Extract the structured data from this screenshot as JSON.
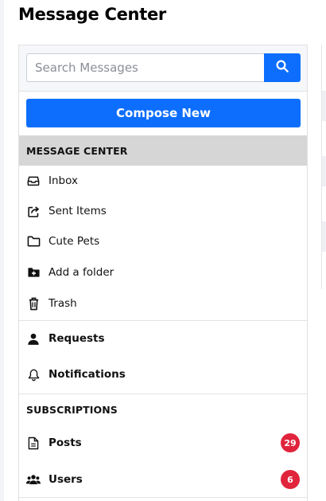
{
  "page": {
    "title": "Message Center"
  },
  "search": {
    "placeholder": "Search Messages",
    "button_icon": "search-icon"
  },
  "compose": {
    "label": "Compose New"
  },
  "colors": {
    "primary": "#0d6efd",
    "badge": "#e0243c",
    "section_header_bg": "#d6d6d6"
  },
  "message_center": {
    "heading": "MESSAGE CENTER",
    "items": [
      {
        "label": "Inbox",
        "icon": "inbox-icon"
      },
      {
        "label": "Sent Items",
        "icon": "share-icon"
      },
      {
        "label": "Cute Pets",
        "icon": "folder-icon"
      },
      {
        "label": "Add a folder",
        "icon": "folder-plus-icon"
      },
      {
        "label": "Trash",
        "icon": "trash-icon"
      }
    ]
  },
  "account": {
    "items": [
      {
        "label": "Requests",
        "icon": "user-icon"
      },
      {
        "label": "Notifications",
        "icon": "bell-icon"
      }
    ]
  },
  "subscriptions": {
    "heading": "SUBSCRIPTIONS",
    "items": [
      {
        "label": "Posts",
        "icon": "document-icon",
        "count": "29"
      },
      {
        "label": "Users",
        "icon": "users-icon",
        "count": "6"
      }
    ]
  }
}
